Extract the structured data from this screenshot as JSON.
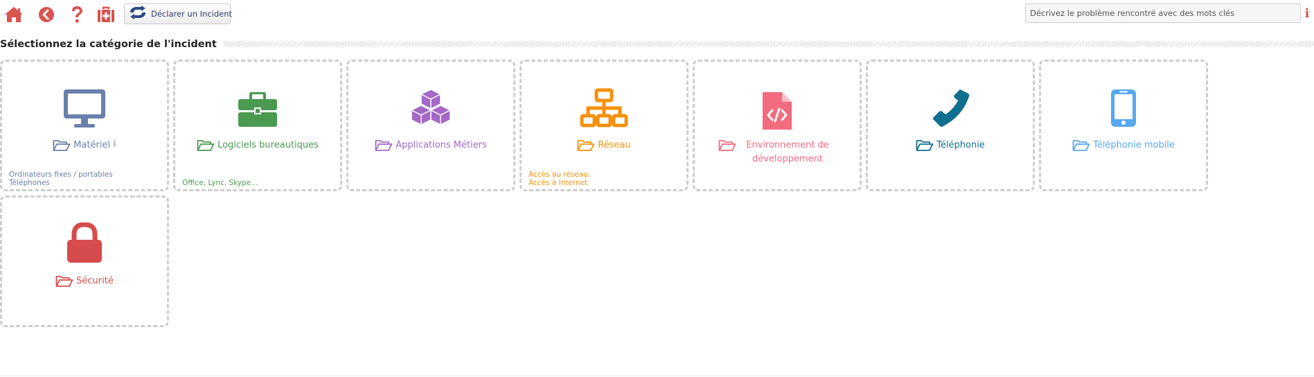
{
  "toolbar": {
    "icons": [
      "home-icon",
      "back-icon",
      "help-icon",
      "first-aid-kit-icon"
    ],
    "declare_button_label": "Déclarer un Incident",
    "search_placeholder": "Décrivez le problème rencontré avec des mots clés",
    "info_label": "i"
  },
  "section": {
    "title": "Sélectionnez la catégorie de l'incident"
  },
  "categories": [
    {
      "label": "Matériel",
      "color": "#6b80ad",
      "icon": "monitor-icon",
      "has_info": true,
      "info_label": "i",
      "desc": [
        "Ordinateurs fixes / portables",
        "Téléphones"
      ]
    },
    {
      "label": "Logiciels bureautiques",
      "color": "#4a9a50",
      "icon": "toolbox-icon",
      "desc": [
        "Office, Lync, Skype..."
      ]
    },
    {
      "label": "Applications Métiers",
      "color": "#a468c6",
      "icon": "cubes-icon",
      "desc": []
    },
    {
      "label": "Réseau",
      "color": "#f5900c",
      "icon": "network-icon",
      "desc": [
        "Accès au réseau,",
        "Accès à Internet"
      ]
    },
    {
      "label": "Environnement de développement",
      "color": "#f26b7f",
      "icon": "code-file-icon",
      "desc": []
    },
    {
      "label": "Téléphonie",
      "color": "#0f6f8e",
      "icon": "phone-icon",
      "desc": []
    },
    {
      "label": "Téléphonie mobile",
      "color": "#57a9ee",
      "icon": "mobile-phone-icon",
      "desc": []
    },
    {
      "label": "Sécurité",
      "color": "#d64b4b",
      "icon": "lock-icon",
      "desc": []
    }
  ],
  "colors": {
    "toolbar_icon": "#d9534f",
    "declare_icon": "#2d4a8a",
    "tile_border": "#cdcdcd"
  }
}
